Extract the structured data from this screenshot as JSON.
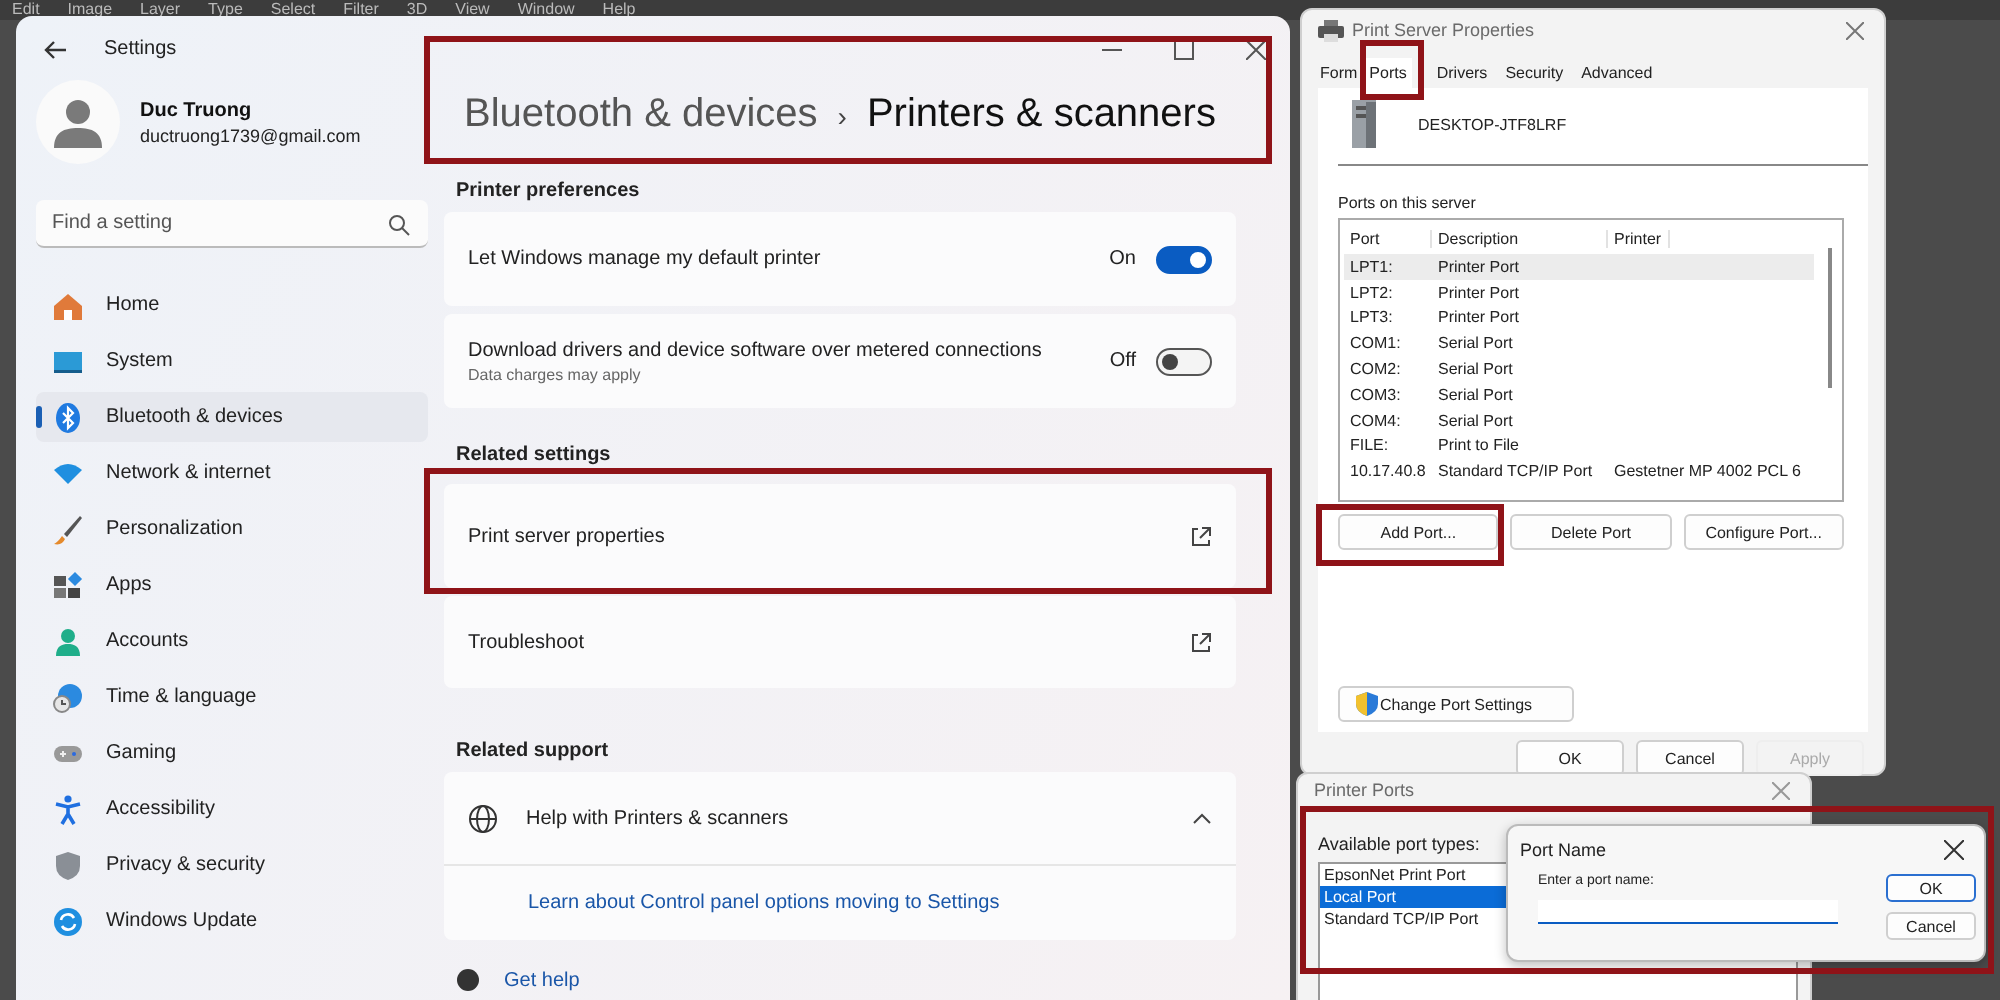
{
  "app_menu": [
    "Edit",
    "Image",
    "Layer",
    "Type",
    "Select",
    "Filter",
    "3D",
    "View",
    "Window",
    "Help"
  ],
  "settings": {
    "title": "Settings",
    "user": {
      "name": "Duc Truong",
      "email": "ductruong1739@gmail.com"
    },
    "search": {
      "placeholder": "Find a setting"
    },
    "nav": [
      {
        "label": "Home",
        "selected": false
      },
      {
        "label": "System",
        "selected": false
      },
      {
        "label": "Bluetooth & devices",
        "selected": true
      },
      {
        "label": "Network & internet",
        "selected": false
      },
      {
        "label": "Personalization",
        "selected": false
      },
      {
        "label": "Apps",
        "selected": false
      },
      {
        "label": "Accounts",
        "selected": false
      },
      {
        "label": "Time & language",
        "selected": false
      },
      {
        "label": "Gaming",
        "selected": false
      },
      {
        "label": "Accessibility",
        "selected": false
      },
      {
        "label": "Privacy & security",
        "selected": false
      },
      {
        "label": "Windows Update",
        "selected": false
      }
    ],
    "breadcrumb": {
      "parent": "Bluetooth & devices",
      "separator": "›",
      "current": "Printers & scanners"
    },
    "sections": [
      {
        "heading": "Printer preferences",
        "items": [
          {
            "kind": "toggle",
            "label": "Let Windows manage my default printer",
            "state_text": "On",
            "on": true
          },
          {
            "kind": "toggle",
            "label": "Download drivers and device software over metered connections",
            "description": "Data charges may apply",
            "state_text": "Off",
            "on": false
          }
        ]
      },
      {
        "heading": "Related settings",
        "items": [
          {
            "kind": "link",
            "label": "Print server properties"
          },
          {
            "kind": "link",
            "label": "Troubleshoot"
          }
        ]
      },
      {
        "heading": "Related support",
        "items": [
          {
            "kind": "expander",
            "label": "Help with Printers & scanners",
            "expanded": true,
            "links": [
              "Learn about Control panel options moving to Settings"
            ]
          }
        ]
      }
    ],
    "get_help": "Get help"
  },
  "print_server": {
    "title": "Print Server Properties",
    "tabs": [
      {
        "label": "Form",
        "selected": false
      },
      {
        "label": "Ports",
        "selected": true
      },
      {
        "label": "Drivers",
        "selected": false
      },
      {
        "label": "Security",
        "selected": false
      },
      {
        "label": "Advanced",
        "selected": false
      }
    ],
    "server_name": "DESKTOP-JTF8LRF",
    "ports_label": "Ports on this server",
    "table": {
      "columns": [
        "Port",
        "Description",
        "Printer"
      ],
      "rows": [
        {
          "cells": [
            "LPT1:",
            "Printer Port",
            ""
          ],
          "selected": true
        },
        {
          "cells": [
            "LPT2:",
            "Printer Port",
            ""
          ],
          "selected": false
        },
        {
          "cells": [
            "LPT3:",
            "Printer Port",
            ""
          ],
          "selected": false
        },
        {
          "cells": [
            "COM1:",
            "Serial Port",
            ""
          ],
          "selected": false
        },
        {
          "cells": [
            "COM2:",
            "Serial Port",
            ""
          ],
          "selected": false
        },
        {
          "cells": [
            "COM3:",
            "Serial Port",
            ""
          ],
          "selected": false
        },
        {
          "cells": [
            "COM4:",
            "Serial Port",
            ""
          ],
          "selected": false
        },
        {
          "cells": [
            "FILE:",
            "Print to File",
            ""
          ],
          "selected": false
        },
        {
          "cells": [
            "10.17.40.8",
            "Standard TCP/IP Port",
            "Gestetner MP 4002 PCL 6"
          ],
          "selected": false
        }
      ]
    },
    "port_buttons": [
      "Add Port...",
      "Delete Port",
      "Configure Port..."
    ],
    "change_button": "Change Port Settings",
    "footer_buttons": [
      {
        "label": "OK",
        "disabled": false
      },
      {
        "label": "Cancel",
        "disabled": false
      },
      {
        "label": "Apply",
        "disabled": true
      }
    ]
  },
  "printer_ports": {
    "title": "Printer Ports",
    "label": "Available port types:",
    "types": [
      {
        "label": "EpsonNet Print Port",
        "selected": false
      },
      {
        "label": "Local Port",
        "selected": true
      },
      {
        "label": "Standard TCP/IP Port",
        "selected": false
      }
    ]
  },
  "port_name": {
    "title": "Port Name",
    "prompt": "Enter a port name:",
    "buttons": [
      "OK",
      "Cancel"
    ]
  }
}
